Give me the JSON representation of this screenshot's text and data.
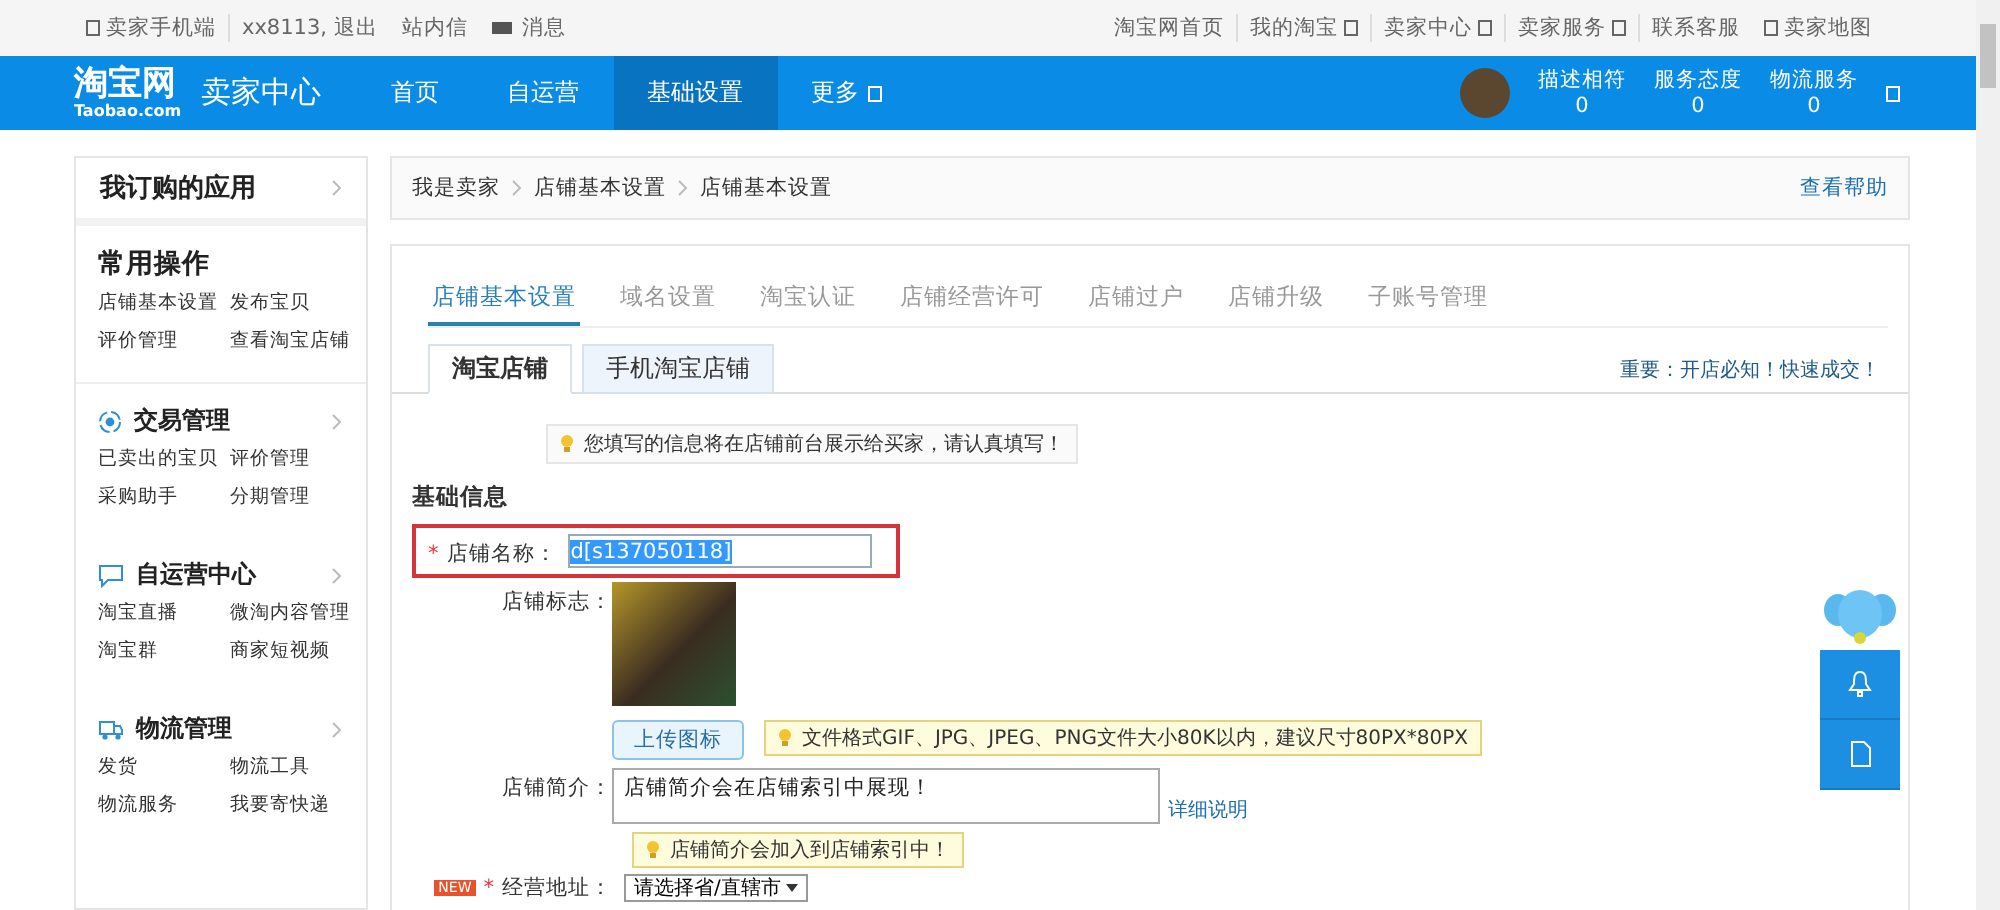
{
  "top_bar": {
    "left": [
      {
        "text": "卖家手机端",
        "kind": "phone"
      },
      {
        "text": "xx8113, 退出",
        "kind": "plain"
      },
      {
        "text": "站内信",
        "kind": "plain"
      },
      {
        "text": "消息",
        "kind": "mail"
      }
    ],
    "right": [
      {
        "text": "淘宝网首页",
        "has_menu": false,
        "kind": "plain"
      },
      {
        "text": "我的淘宝",
        "has_menu": true,
        "kind": "plain"
      },
      {
        "text": "卖家中心",
        "has_menu": true,
        "kind": "plain"
      },
      {
        "text": "卖家服务",
        "has_menu": true,
        "kind": "plain"
      },
      {
        "text": "联系客服",
        "has_menu": false,
        "kind": "plain"
      },
      {
        "text": "卖家地图",
        "has_menu": false,
        "kind": "map"
      }
    ]
  },
  "header": {
    "logo": {
      "main": "淘宝网",
      "sub": "Taobao.com"
    },
    "title": "卖家中心",
    "nav": [
      {
        "label": "首页",
        "selected": false,
        "has_menu": false
      },
      {
        "label": "自运营",
        "selected": false,
        "has_menu": false
      },
      {
        "label": "基础设置",
        "selected": true,
        "has_menu": false
      },
      {
        "label": "更多",
        "selected": false,
        "has_menu": true
      }
    ],
    "ratings": [
      {
        "label": "描述相符",
        "value": "0"
      },
      {
        "label": "服务态度",
        "value": "0"
      },
      {
        "label": "物流服务",
        "value": "0"
      }
    ]
  },
  "sidebar": {
    "apps_title": "我订购的应用",
    "sections": [
      {
        "title": "常用操作",
        "kind": "plain",
        "links": [
          "店铺基本设置",
          "发布宝贝",
          "评价管理",
          "查看淘宝店铺"
        ]
      },
      {
        "title": "交易管理",
        "kind": "trade",
        "links": [
          "已卖出的宝贝",
          "评价管理",
          "采购助手",
          "分期管理"
        ]
      },
      {
        "title": "自运营中心",
        "kind": "chat",
        "links": [
          "淘宝直播",
          "微淘内容管理",
          "淘宝群",
          "商家短视频"
        ]
      },
      {
        "title": "物流管理",
        "kind": "truck",
        "links": [
          "发货",
          "物流工具",
          "物流服务",
          "我要寄快递"
        ]
      }
    ]
  },
  "breadcrumb": {
    "items": [
      "我是卖家",
      "店铺基本设置",
      "店铺基本设置"
    ],
    "help": "查看帮助"
  },
  "tabs": [
    {
      "label": "店铺基本设置",
      "selected": true
    },
    {
      "label": "域名设置",
      "selected": false
    },
    {
      "label": "淘宝认证",
      "selected": false
    },
    {
      "label": "店铺经营许可",
      "selected": false
    },
    {
      "label": "店铺过户",
      "selected": false
    },
    {
      "label": "店铺升级",
      "selected": false
    },
    {
      "label": "子账号管理",
      "selected": false
    }
  ],
  "subtabs": [
    {
      "label": "淘宝店铺",
      "selected": true
    },
    {
      "label": "手机淘宝店铺",
      "selected": false
    }
  ],
  "important_link": "重要：开店必知！快速成交！",
  "notice": "您填写的信息将在店铺前台展示给买家，请认真填写！",
  "section_title": "基础信息",
  "form": {
    "name": {
      "label": "店铺名称：",
      "mark": "*",
      "value": "d[s137050118]",
      "highlighted": true
    },
    "logo": {
      "label": "店铺标志：",
      "upload": "上传图标",
      "hint": "文件格式GIF、JPG、JPEG、PNG文件大小80K以内，建议尺寸80PX*80PX"
    },
    "intro": {
      "label": "店铺简介：",
      "value": "店铺简介会在店铺索引中展现！",
      "link": "详细说明",
      "hint": "店铺简介会加入到店铺索引中！"
    },
    "address": {
      "badge": "NEW",
      "label": "经营地址：",
      "mark": "*",
      "select": "请选择省/直辖市"
    }
  }
}
